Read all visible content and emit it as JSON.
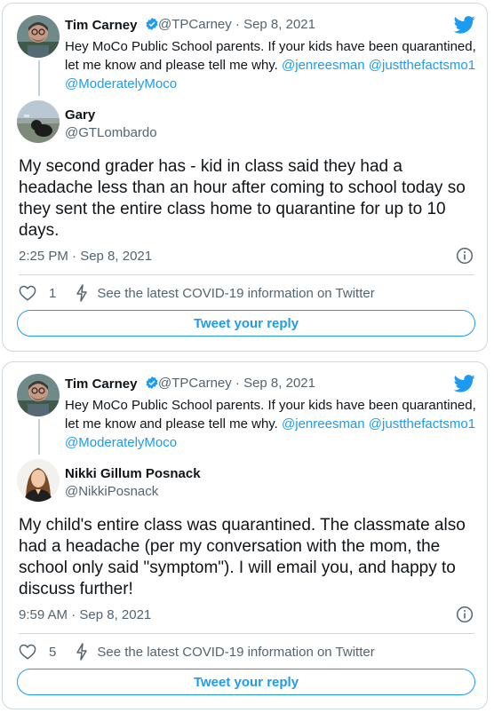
{
  "tweets": [
    {
      "parent": {
        "name": "Tim Carney",
        "handle_date": "@TPCarney · Sep 8, 2021",
        "text_lines": [
          "Hey MoCo Public School parents. If your kids have been quarantined,",
          "let me know and please tell me why."
        ],
        "mentions_line1": "@jenreesman @justthefactsmo1",
        "mentions_line2": "@ModeratelyMoco"
      },
      "reply": {
        "name": "Gary",
        "handle": "@GTLombardo",
        "text": "My second grader has - kid in class said they had a headache less than an hour after coming to school today so they sent the entire class home to quarantine for up to 10 days.",
        "timestamp": "2:25 PM · Sep 8, 2021",
        "likes": "1",
        "covid_text": "See the latest COVID-19 information on Twitter",
        "reply_button": "Tweet your reply"
      }
    },
    {
      "parent": {
        "name": "Tim Carney",
        "handle_date": "@TPCarney · Sep 8, 2021",
        "text_lines": [
          "Hey MoCo Public School parents. If your kids have been quarantined,",
          "let me know and please tell me why."
        ],
        "mentions_line1": "@jenreesman @justthefactsmo1",
        "mentions_line2": "@ModeratelyMoco"
      },
      "reply": {
        "name": "Nikki Gillum Posnack",
        "handle": "@NikkiPosnack",
        "text": "My child's entire class was quarantined. The classmate also had a headache (per my conversation with the mom, the school only said \"symptom\"). I will email you, and happy to discuss further!",
        "timestamp": "9:59 AM · Sep 8, 2021",
        "likes": "5",
        "covid_text": "See the latest COVID-19 information on Twitter",
        "reply_button": "Tweet your reply"
      }
    }
  ],
  "icons": [
    "twitter-bird-icon",
    "verified-badge-icon",
    "info-icon",
    "heart-icon",
    "bolt-icon"
  ],
  "colors": {
    "accent": "#1d9bf0",
    "text": "#0f1419",
    "muted": "#536471",
    "border": "#cfd9de"
  }
}
